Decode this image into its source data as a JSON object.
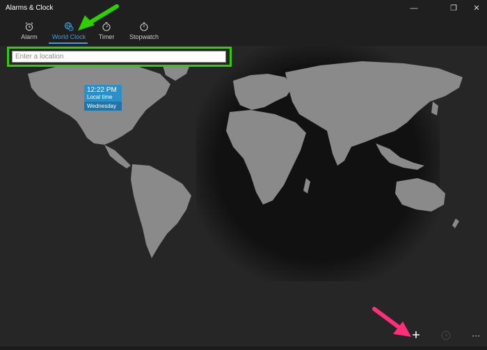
{
  "window": {
    "title": "Alarms & Clock",
    "controls": {
      "minimize": "—",
      "maximize": "❐",
      "close": "✕"
    }
  },
  "tabs": [
    {
      "label": "Alarm",
      "icon": "alarm-icon"
    },
    {
      "label": "World Clock",
      "icon": "world-clock-icon",
      "active": true
    },
    {
      "label": "Timer",
      "icon": "timer-icon"
    },
    {
      "label": "Stopwatch",
      "icon": "stopwatch-icon"
    }
  ],
  "search": {
    "placeholder": "Enter a location",
    "value": ""
  },
  "local_clock": {
    "time": "12:22 PM",
    "label": "Local time",
    "day": "Wednesday"
  },
  "bottom_bar": {
    "add_label": "+",
    "more_label": "···"
  },
  "colors": {
    "accent": "#3aa0e0",
    "highlight_box": "#2fd000",
    "annotation_arrow_1": "#2fd000",
    "annotation_arrow_2": "#ff2d7a",
    "land": "#8a8a8a",
    "night": "#121212"
  }
}
